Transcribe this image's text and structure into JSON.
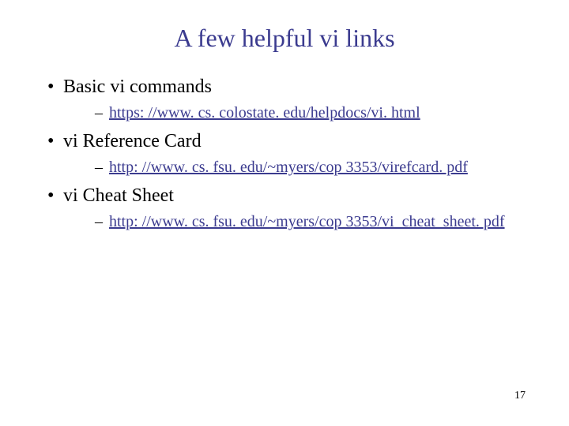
{
  "title": "A few helpful vi links",
  "items": [
    {
      "label": "Basic vi commands",
      "link": "https: //www. cs. colostate. edu/helpdocs/vi. html"
    },
    {
      "label": "vi Reference Card",
      "link": "http: //www. cs. fsu. edu/~myers/cop 3353/virefcard. pdf"
    },
    {
      "label": "vi Cheat Sheet",
      "link": "http: //www. cs. fsu. edu/~myers/cop 3353/vi_cheat_sheet. pdf"
    }
  ],
  "pageNumber": "17"
}
